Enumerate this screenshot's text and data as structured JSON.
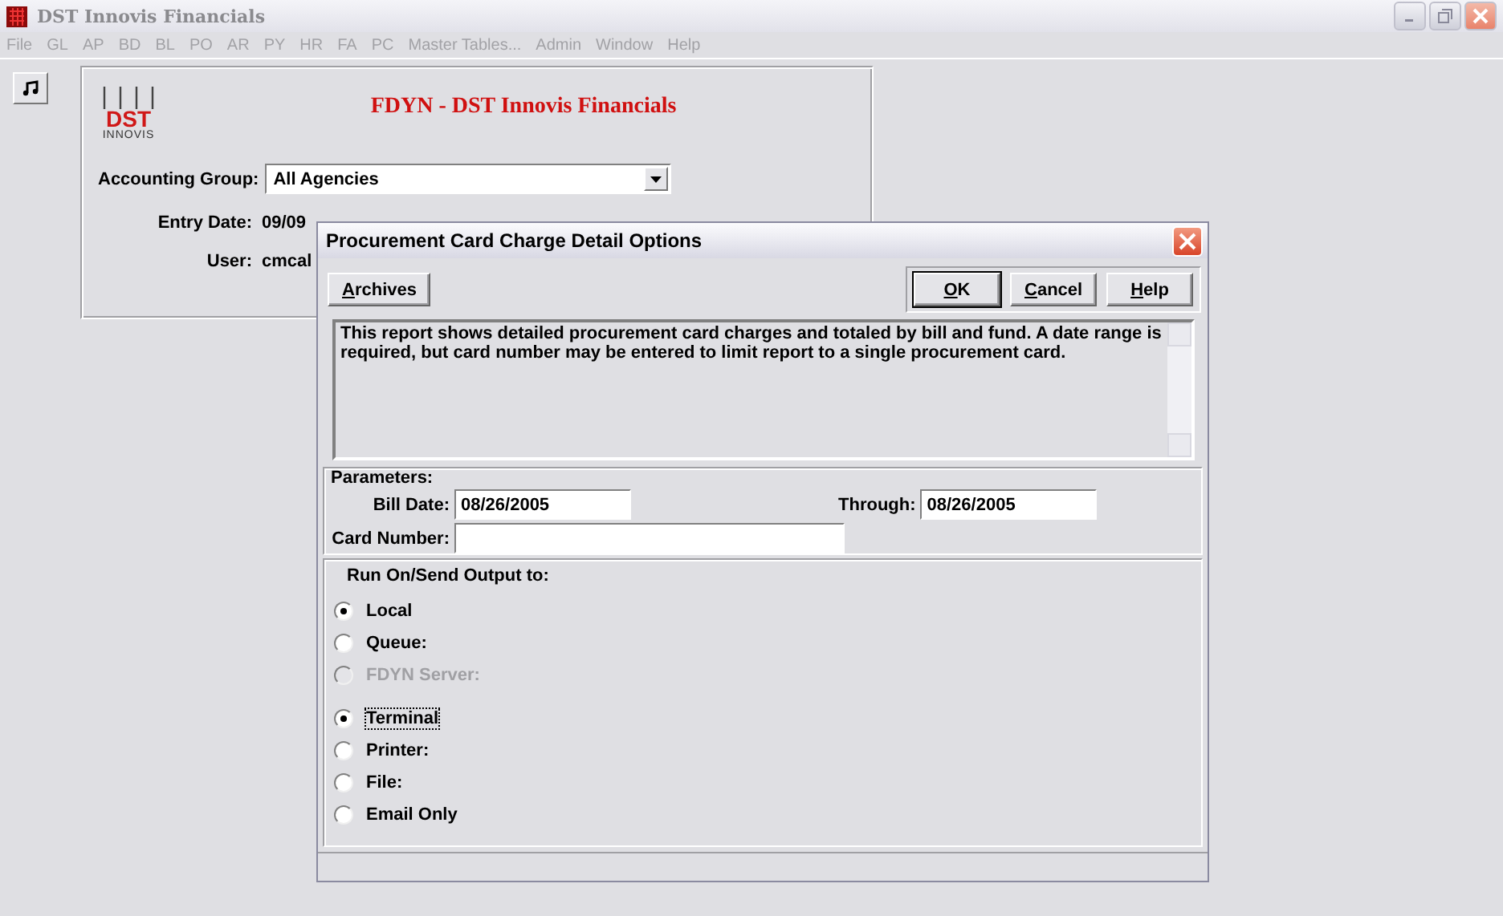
{
  "window": {
    "title": "DST Innovis Financials"
  },
  "menu": [
    "File",
    "GL",
    "AP",
    "BD",
    "BL",
    "PO",
    "AR",
    "PY",
    "HR",
    "FA",
    "PC",
    "Master Tables...",
    "Admin",
    "Window",
    "Help"
  ],
  "main_panel": {
    "logo": {
      "text": "DST",
      "subtext": "INNOVIS"
    },
    "title": "FDYN - DST Innovis Financials",
    "accounting_group": {
      "label": "Accounting Group:",
      "value": "All Agencies"
    },
    "entry_date": {
      "label": "Entry Date:",
      "value": "09/09"
    },
    "user": {
      "label": "User:",
      "value": "cmcal"
    }
  },
  "dialog": {
    "title": "Procurement Card Charge Detail Options",
    "archives_button": "Archives",
    "buttons": [
      {
        "label": "OK",
        "default": true
      },
      {
        "label": "Cancel",
        "default": false
      },
      {
        "label": "Help",
        "default": false
      }
    ],
    "description": "This report shows detailed procurement card charges and totaled by bill and fund.  A date range is required, but card number may be entered to limit report to a single procurement card.",
    "parameters": {
      "legend": "Parameters:",
      "bill_date": {
        "label": "Bill Date:",
        "value": "08/26/2005"
      },
      "through": {
        "label": "Through:",
        "value": "08/26/2005"
      },
      "card_number": {
        "label": "Card Number:"
      }
    },
    "output": {
      "legend": "Run On/Send Output to:",
      "run_on": [
        {
          "label": "Local",
          "selected": true,
          "disabled": false
        },
        {
          "label": "Queue:",
          "selected": false,
          "disabled": false
        },
        {
          "label": "FDYN Server:",
          "selected": false,
          "disabled": true
        }
      ],
      "send_to": [
        {
          "label": "Terminal",
          "selected": true,
          "focused": true
        },
        {
          "label": "Printer:",
          "selected": false,
          "focused": false
        },
        {
          "label": "File:",
          "selected": false,
          "focused": false
        },
        {
          "label": "Email Only",
          "selected": false,
          "focused": false
        }
      ]
    }
  }
}
